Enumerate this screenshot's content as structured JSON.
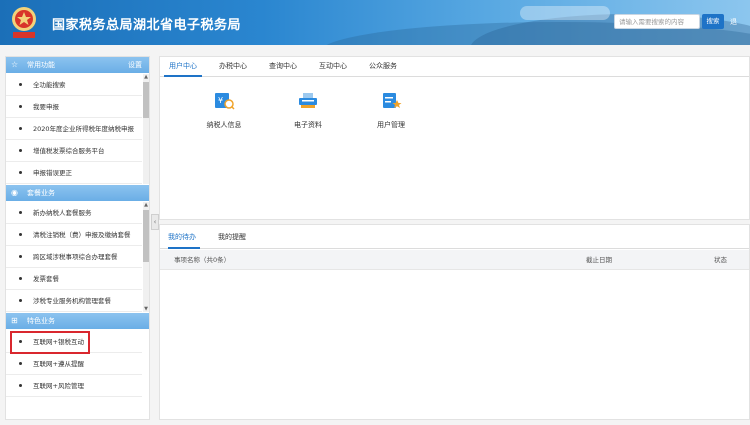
{
  "header": {
    "title": "国家税务总局湖北省电子税务局",
    "logo_text": "中国税务",
    "search_placeholder": "请输入需要搜索的内容",
    "search_button": "搜索",
    "exit_label": "退"
  },
  "sidebar": {
    "sections": [
      {
        "title": "常用功能",
        "action": "设置",
        "icon": "star-icon",
        "items": [
          "全功能搜索",
          "我要申报",
          "2020年度企业所得税年度纳税申报",
          "增值税发票综合服务平台",
          "申报错误更正"
        ]
      },
      {
        "title": "套餐业务",
        "icon": "package-icon",
        "items": [
          "新办纳税人套餐服务",
          "清税注销税（费）申报及缴纳套餐",
          "跨区域涉税事项综合办理套餐",
          "发票套餐",
          "涉税专业服务机构管理套餐"
        ]
      },
      {
        "title": "特色业务",
        "icon": "feature-icon",
        "items": [
          "互联网+银税互动",
          "互联网+遵从提醒",
          "互联网+风险管理"
        ]
      }
    ],
    "collapse_glyph": "‹"
  },
  "main": {
    "tabs": [
      "用户中心",
      "办税中心",
      "查询中心",
      "互动中心",
      "公众服务"
    ],
    "active_tab": 0,
    "services": [
      {
        "label": "纳税人信息",
        "icon": "taxpayer-info-icon"
      },
      {
        "label": "电子资料",
        "icon": "electronic-data-icon"
      },
      {
        "label": "用户管理",
        "icon": "user-management-icon"
      }
    ]
  },
  "todo": {
    "tabs": [
      "我的待办",
      "我的提醒"
    ],
    "active_tab": 0,
    "columns": [
      "事项名称（共0条）",
      "截止日期",
      "状态"
    ]
  },
  "colors": {
    "accent": "#1e73c7",
    "section_header": "#7ab8ea",
    "highlight_border": "#d9272e"
  }
}
